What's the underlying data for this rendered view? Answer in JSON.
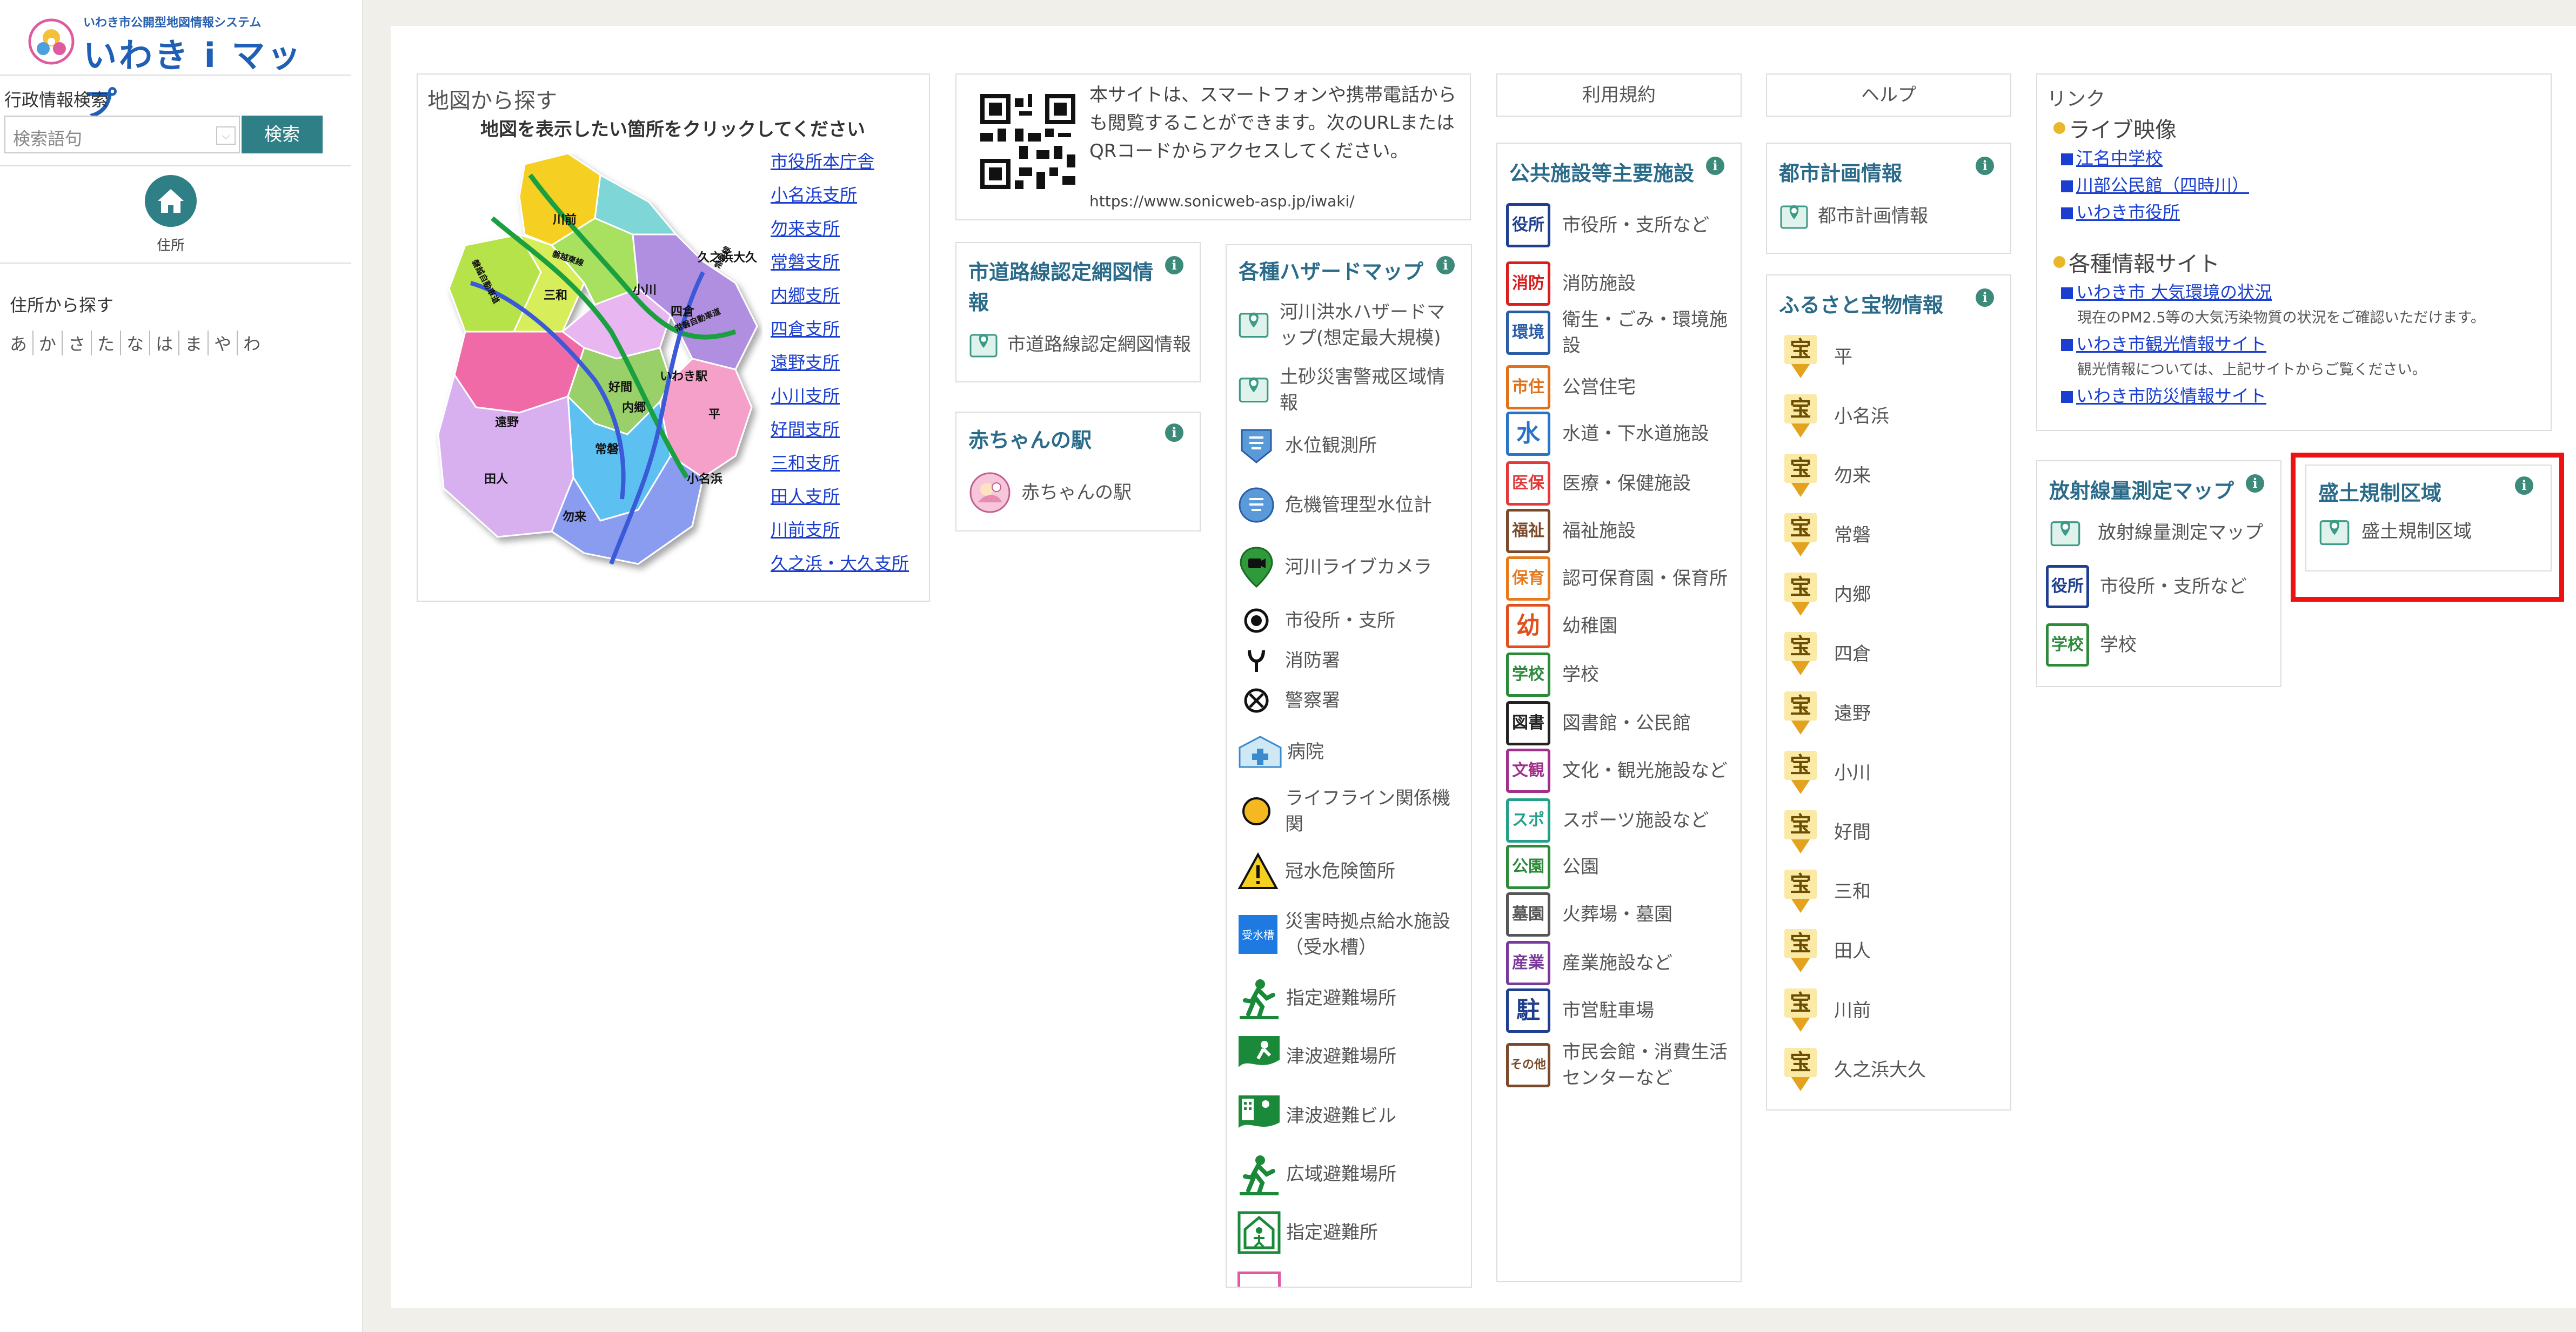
{
  "logo": {
    "sub": "いわき市公開型地図情報システム",
    "main": "いわき i マップ"
  },
  "sidebar": {
    "admin_search_title": "行政情報検索",
    "search_placeholder": "検索語句",
    "search_button": "検索",
    "address_label": "住所",
    "address_search_title": "住所から探す",
    "kana": [
      "あ",
      "か",
      "さ",
      "た",
      "な",
      "は",
      "ま",
      "や",
      "わ"
    ]
  },
  "map_card": {
    "title": "地図から探す",
    "subtitle": "地図を表示したい箇所をクリックしてください",
    "links": [
      "市役所本庁舎",
      "小名浜支所",
      "勿来支所",
      "常磐支所",
      "内郷支所",
      "四倉支所",
      "遠野支所",
      "小川支所",
      "好間支所",
      "三和支所",
      "田人支所",
      "川前支所",
      "久之浜・大久支所"
    ],
    "regions": [
      "川前",
      "三和",
      "小川",
      "久之浜大久",
      "四倉",
      "好間",
      "いわき駅",
      "内郷",
      "遠野",
      "平",
      "常磐",
      "田人",
      "小名浜",
      "勿来"
    ],
    "routes": [
      "磐越東線",
      "磐越自動車道",
      "常磐線",
      "常磐自動車道"
    ]
  },
  "qr_card": {
    "text": "本サイトは、スマートフォンや携帯電話からも閲覧することができます。次のURLまたはQRコードからアクセスしてください。",
    "url": "https://www.sonicweb-asp.jp/iwaki/"
  },
  "road_card": {
    "title": "市道路線認定網図情報",
    "item": "市道路線認定網図情報"
  },
  "baby_card": {
    "title": "赤ちゃんの駅",
    "item": "赤ちゃんの駅"
  },
  "hazard_card": {
    "title": "各種ハザードマップ",
    "items": [
      "河川洪水ハザードマップ(想定最大規模)",
      "土砂災害警戒区域情報",
      "水位観測所",
      "危機管理型水位計",
      "河川ライブカメラ",
      "市役所・支所",
      "消防署",
      "警察署",
      "病院",
      "ライフライン関係機関",
      "冠水危険箇所",
      "災害時拠点給水施設（受水槽）",
      "指定避難場所",
      "津波避難場所",
      "津波避難ビル",
      "広域避難場所",
      "指定避難所"
    ]
  },
  "terms_button": "利用規約",
  "public_card": {
    "title": "公共施設等主要施設",
    "items": [
      "市役所・支所など",
      "消防施設",
      "衛生・ごみ・環境施設",
      "公営住宅",
      "水道・下水道施設",
      "医療・保健施設",
      "福祉施設",
      "認可保育園・保育所",
      "幼稚園",
      "学校",
      "図書館・公民館",
      "文化・観光施設など",
      "スポーツ施設など",
      "公園",
      "火葬場・墓園",
      "産業施設など",
      "市営駐車場",
      "市民会館・消費生活センターなど"
    ],
    "icons": [
      "役所",
      "消防",
      "環境",
      "市住",
      "水",
      "医保",
      "福祉",
      "保育",
      "幼",
      "学校",
      "図書",
      "文観",
      "スポ",
      "公園",
      "墓園",
      "産業",
      "駐",
      "その他"
    ],
    "colors": [
      "#1e3f8f",
      "#d81e1e",
      "#2a5ca8",
      "#e0701a",
      "#2a74c8",
      "#e23a3a",
      "#7a4a2a",
      "#e87a1e",
      "#e0501e",
      "#2d8a3a",
      "#222222",
      "#a0308a",
      "#23a08a",
      "#2d8a3a",
      "#555555",
      "#7a3a9a",
      "#1e3f8f",
      "#7a4a2a"
    ]
  },
  "help_button": "ヘルプ",
  "city_card": {
    "title": "都市計画情報",
    "item": "都市計画情報"
  },
  "treasure_card": {
    "title": "ふるさと宝物情報",
    "icon_char": "宝",
    "items": [
      "平",
      "小名浜",
      "勿来",
      "常磐",
      "内郷",
      "四倉",
      "遠野",
      "小川",
      "好間",
      "三和",
      "田人",
      "川前",
      "久之浜大久"
    ]
  },
  "links_card": {
    "title": "リンク",
    "live_title": "ライブ映像",
    "live_links": [
      "江名中学校",
      "川部公民館（四時川）",
      "いわき市役所"
    ],
    "info_title": "各種情報サイト",
    "air_link": "いわき市 大気環境の状況",
    "air_note": "現在のPM2.5等の大気汚染物質の状況をご確認いただけます。",
    "tourism_link": "いわき市観光情報サイト",
    "tourism_note": "観光情報については、上記サイトからご覧ください。",
    "disaster_link": "いわき市防災情報サイト"
  },
  "radiation_card": {
    "title": "放射線量測定マップ",
    "items": [
      "放射線量測定マップ",
      "市役所・支所など",
      "学校"
    ]
  },
  "fill_card": {
    "title": "盛土規制区域",
    "item": "盛土規制区域"
  },
  "colors": {
    "accent": "#2f7f86",
    "title": "#2a6b8a",
    "highlight": "#ee1111",
    "link": "#1a3ecf"
  }
}
